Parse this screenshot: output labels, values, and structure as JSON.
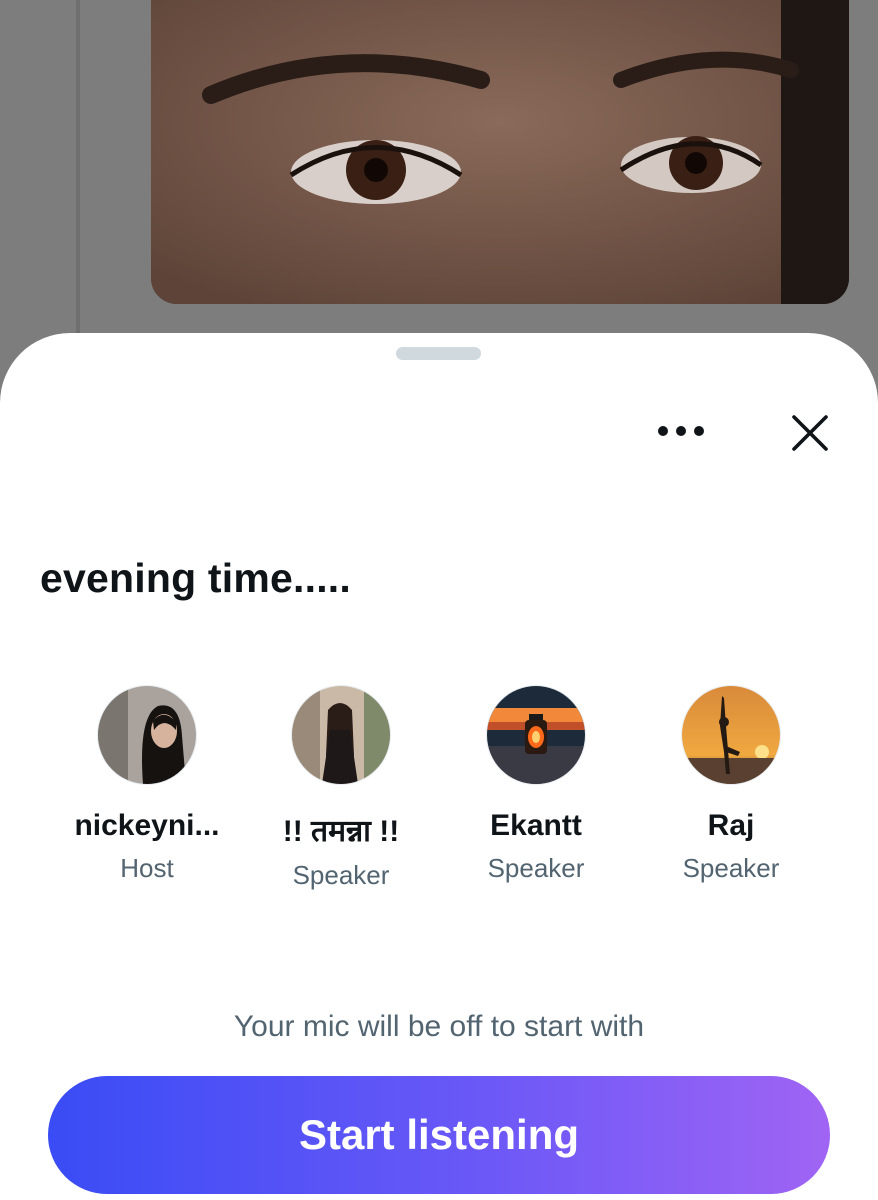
{
  "space": {
    "title": "evening time....."
  },
  "participants": [
    {
      "name": "nickeyni...",
      "role": "Host",
      "avatar": "host-avatar"
    },
    {
      "name": "!! तमन्ना !!",
      "role": "Speaker",
      "avatar": "speaker-avatar"
    },
    {
      "name": "Ekantt",
      "role": "Speaker",
      "avatar": "lantern-avatar"
    },
    {
      "name": "Raj",
      "role": "Speaker",
      "avatar": "yoga-sunset-avatar"
    }
  ],
  "controls": {
    "more_icon": "more-horizontal-icon",
    "close_icon": "close-icon"
  },
  "mic_notice": "Your mic will be off to start with",
  "cta": {
    "label": "Start listening"
  },
  "colors": {
    "primary_text": "#0f1419",
    "secondary_text": "#536471",
    "cta_gradient_start": "#3a4cf5",
    "cta_gradient_end": "#a064f4",
    "overlay": "#7d7d7d"
  }
}
